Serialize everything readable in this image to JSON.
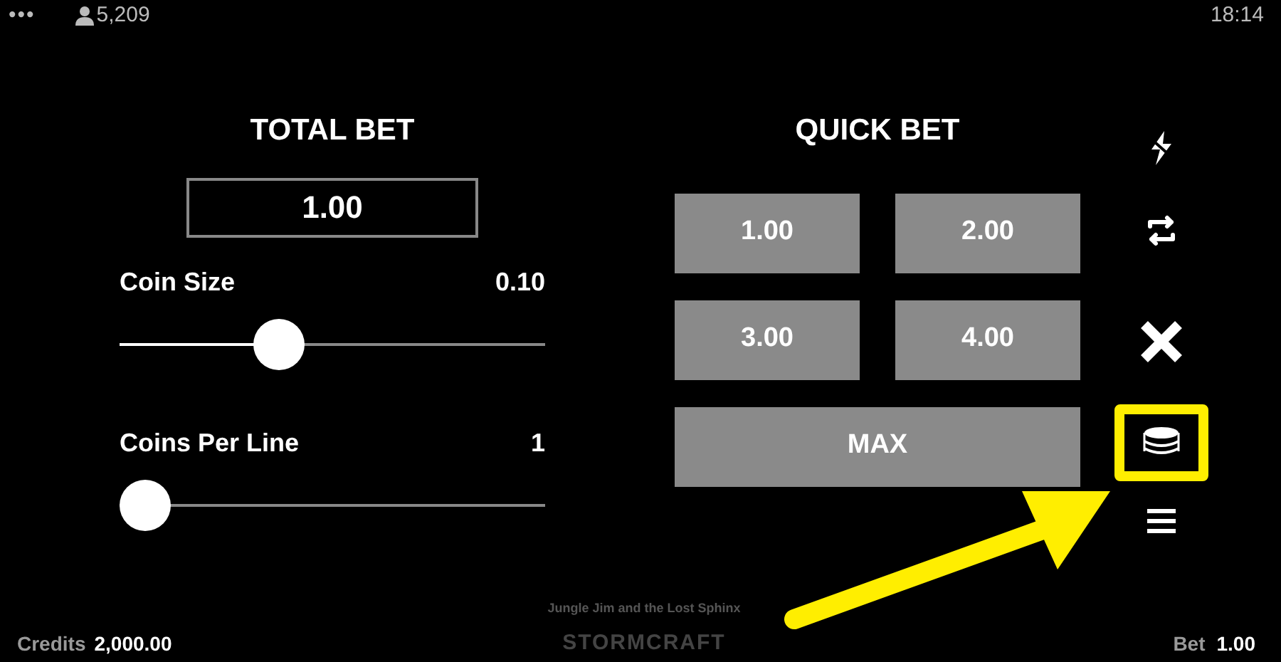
{
  "status_bar": {
    "menu": "•••",
    "players": "5,209",
    "time": "18:14"
  },
  "total_bet": {
    "title": "TOTAL BET",
    "value": "1.00"
  },
  "sliders": [
    {
      "label": "Coin Size",
      "reading": "0.10",
      "level": 0.375
    },
    {
      "label": "Coins Per Line",
      "reading": "1",
      "level": 0
    }
  ],
  "quick_bet": {
    "title": "QUICK BET",
    "buttons": [
      "1.00",
      "2.00",
      "3.00",
      "4.00"
    ],
    "max": "MAX"
  },
  "side_icons": [
    {
      "kind": "turbo",
      "highlighted": false
    },
    {
      "kind": "autoplay",
      "highlighted": false
    },
    {
      "kind": "close",
      "highlighted": false
    },
    {
      "kind": "bet",
      "highlighted": true
    },
    {
      "kind": "menu",
      "highlighted": false
    }
  ],
  "footer": {
    "credits_label": "Credits",
    "credits": "2,000.00",
    "game_title": "Jungle Jim and the Lost Sphinx",
    "brand": "STORMCRAFT",
    "bet_label": "Bet",
    "bet": "1.00"
  }
}
